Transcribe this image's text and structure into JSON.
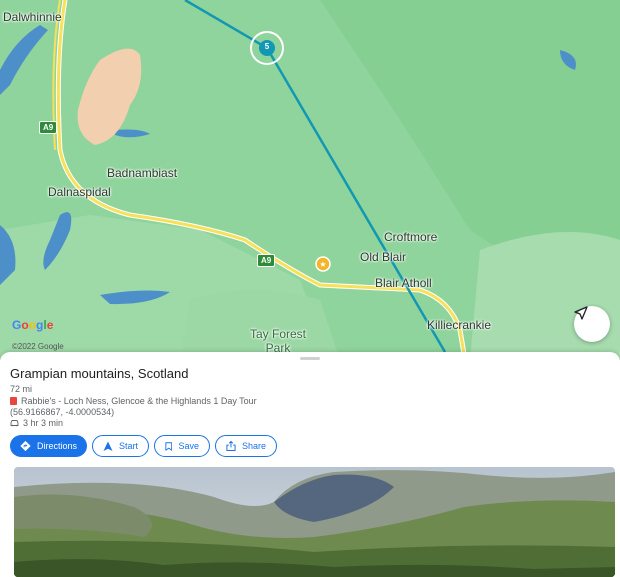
{
  "map": {
    "places": [
      {
        "id": "dalwhinnie",
        "label": "Dalwhinnie"
      },
      {
        "id": "badnambiast",
        "label": "Badnambiast"
      },
      {
        "id": "dalnaspidal",
        "label": "Dalnaspidal"
      },
      {
        "id": "croftmore",
        "label": "Croftmore"
      },
      {
        "id": "old-blair",
        "label": "Old Blair"
      },
      {
        "id": "blair-atholl",
        "label": "Blair Atholl"
      },
      {
        "id": "killiecrankie",
        "label": "Killiecrankie"
      },
      {
        "id": "tay-forest-park",
        "label": "Tay Forest Park"
      }
    ],
    "road_label": "A9",
    "route_marker_label": "5",
    "logo": "Google",
    "copyright": "©2022 Google",
    "colors": {
      "route": "#1298b2",
      "land": "#8fd49c",
      "road": "#f7e15a",
      "water": "#4d90c9",
      "accent": "#1a73e8"
    }
  },
  "sheet": {
    "title": "Grampian mountains, Scotland",
    "distance": "72 mi",
    "tour": "Rabbie's - Loch Ness, Glencoe & the Highlands 1 Day Tour",
    "coordinates": "(56.9166867, -4.0000534)",
    "duration": "3 hr 3 min",
    "buttons": {
      "directions": "Directions",
      "start": "Start",
      "save": "Save",
      "share": "Share"
    }
  }
}
